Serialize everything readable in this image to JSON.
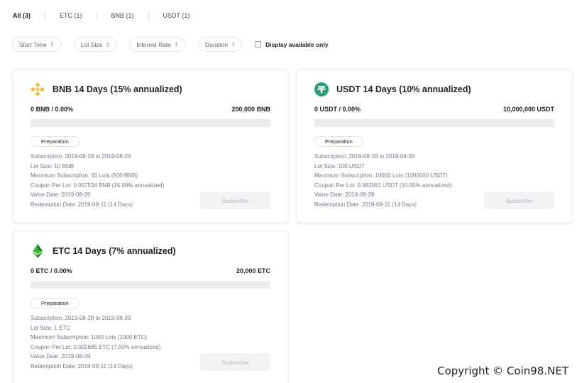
{
  "tabs": [
    {
      "label": "All (3)",
      "active": true
    },
    {
      "label": "ETC (1)",
      "active": false
    },
    {
      "label": "BNB (1)",
      "active": false
    },
    {
      "label": "USDT (1)",
      "active": false
    }
  ],
  "filters": {
    "start_time": "Start Time",
    "lot_size": "Lot Size",
    "interest_rate": "Interest Rate",
    "duration": "Duration",
    "display_available": "Display available only"
  },
  "cards": [
    {
      "icon": "bnb-coin-icon",
      "title": "BNB 14 Days (15% annualized)",
      "amount_left": "0 BNB / 0.00%",
      "amount_right": "200,000 BNB",
      "progress": 0,
      "status": "Preparation",
      "details": [
        "Subscription: 2019-08-28 to 2019-08-29",
        "Lot Size: 10 BNB",
        "Maximum Subscription: 50 Lots (500 BNB)",
        "Coupon Per Lot: 0.057534 BNB (15.00% annualized)",
        "Value Date: 2019-08-29",
        "Redemption Date: 2019-09-11 (14 Days)"
      ],
      "button": "Subscribe"
    },
    {
      "icon": "usdt-coin-icon",
      "title": "USDT 14 Days (10% annualized)",
      "amount_left": "0 USDT / 0.00%",
      "amount_right": "10,000,000 USDT",
      "progress": 0,
      "status": "Preparation",
      "details": [
        "Subscription: 2019-08-28 to 2019-08-29",
        "Lot Size: 100 USDT",
        "Maximum Subscription: 10000 Lots (1000000 USDT)",
        "Coupon Per Lot: 0.383561 USDT (10.00% annualized)",
        "Value Date: 2019-08-29",
        "Redemption Date: 2019-09-11 (14 Days)"
      ],
      "button": "Subscribe"
    },
    {
      "icon": "etc-coin-icon",
      "title": "ETC 14 Days (7% annualized)",
      "amount_left": "0 ETC / 0.00%",
      "amount_right": "20,000 ETC",
      "progress": 0,
      "status": "Preparation",
      "details": [
        "Subscription: 2019-08-28 to 2019-08-29",
        "Lot Size: 1 ETC",
        "Maximum Subscription: 1000 Lots (1000 ETC)",
        "Coupon Per Lot: 0.002685 ETC (7.00% annualized)",
        "Value Date: 2019-08-29",
        "Redemption Date: 2019-09-11 (14 Days)"
      ],
      "button": "Subscribe"
    }
  ],
  "colors": {
    "bnb": "#f3ba2f",
    "usdt": "#26a17b",
    "etc": "#3ab83a"
  },
  "copyright": "Copyright © Coin98.NET"
}
